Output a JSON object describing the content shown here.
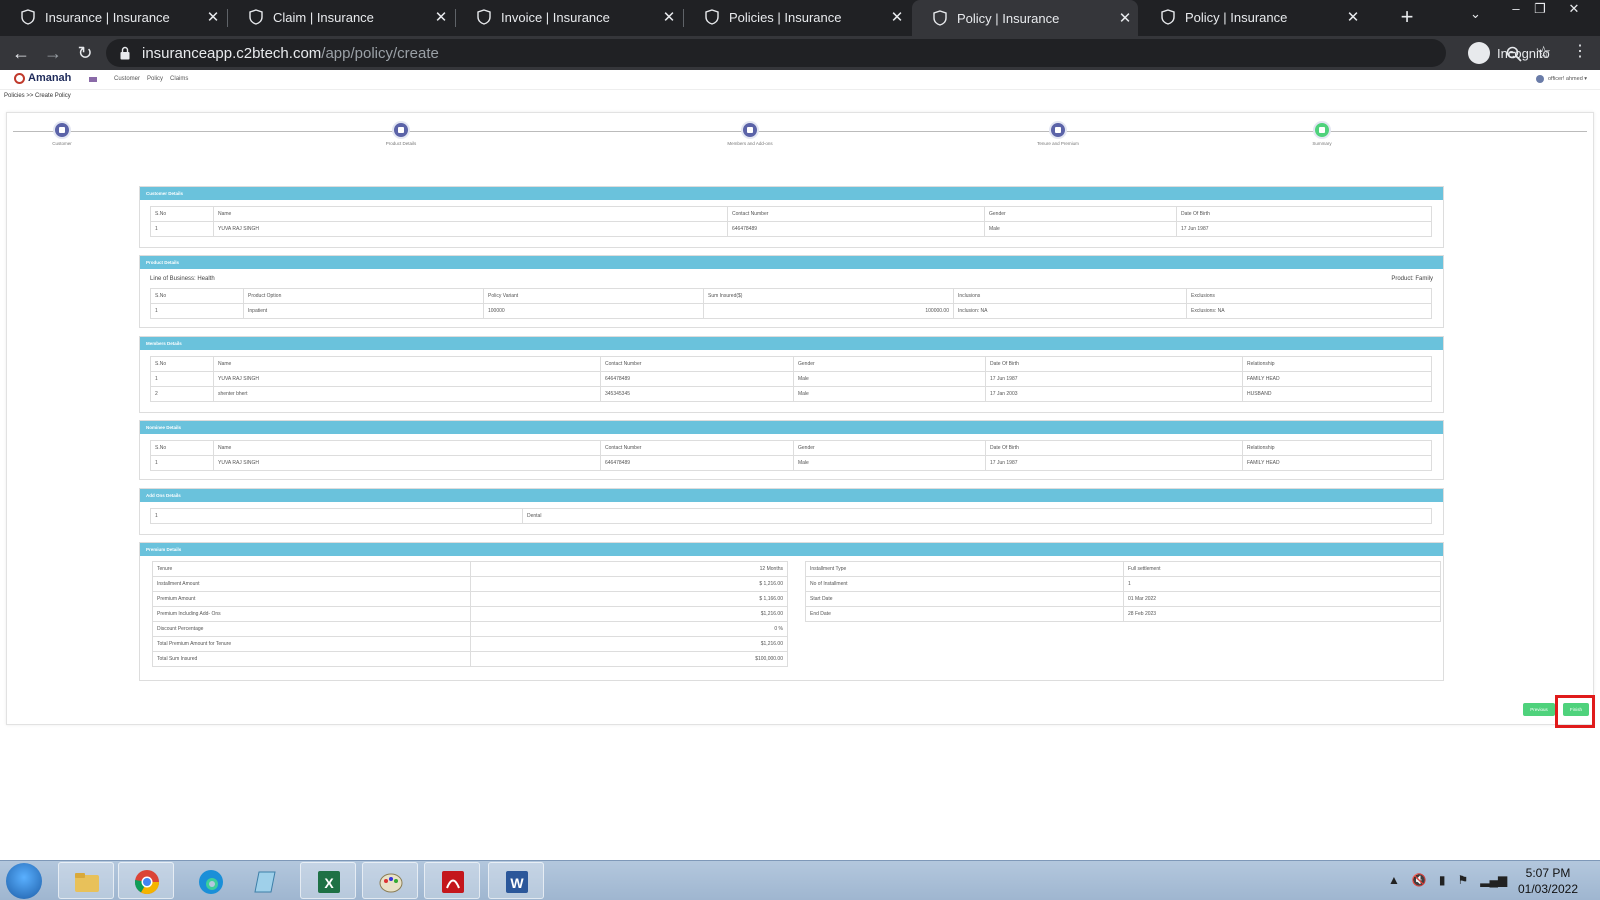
{
  "browser": {
    "tabs": [
      {
        "title": "Insurance | Insurance",
        "active": false
      },
      {
        "title": "Claim | Insurance",
        "active": false
      },
      {
        "title": "Invoice | Insurance",
        "active": false
      },
      {
        "title": "Policies | Insurance",
        "active": false
      },
      {
        "title": "Policy | Insurance",
        "active": true
      },
      {
        "title": "Policy | Insurance",
        "active": false
      }
    ],
    "url_host": "insuranceapp.c2btech.com",
    "url_path": "/app/policy/create",
    "incognito_label": "Incognito"
  },
  "app": {
    "logo_text": "Amanah",
    "nav": [
      "Customer",
      "Policy",
      "Claims"
    ],
    "user": "officer! ahmed ▾",
    "breadcrumb": "Policies >> Create Policy"
  },
  "steps": [
    {
      "label": "Customer",
      "color": "#5b63a8"
    },
    {
      "label": "Product Details",
      "color": "#5b63a8"
    },
    {
      "label": "Members and Add-ons",
      "color": "#5b63a8"
    },
    {
      "label": "Tenure and Premium",
      "color": "#5b63a8"
    },
    {
      "label": "Summary",
      "color": "#4fd27c"
    }
  ],
  "customer": {
    "heading": "Customer Details",
    "headers": [
      "S.No",
      "Name",
      "Contact Number",
      "Gender",
      "Date Of Birth"
    ],
    "rows": [
      [
        "1",
        "YUVA RAJ SINGH",
        "646478489",
        "Male",
        "17 Jun 1987"
      ]
    ]
  },
  "product": {
    "heading": "Product Details",
    "lob": "Line of Business: Health",
    "product": "Product: Family",
    "headers": [
      "S.No",
      "Product Option",
      "Policy Variant",
      "Sum Insured($)",
      "Inclusions",
      "Exclusions"
    ],
    "rows": [
      [
        "1",
        "Inpatient",
        "100000",
        "100000.00",
        "Inclusion:  NA",
        "Exclusions:  NA"
      ]
    ]
  },
  "members": {
    "heading": "Members Details",
    "headers": [
      "S.No",
      "Name",
      "Contact Number",
      "Gender",
      "Date Of Birth",
      "Relationship"
    ],
    "rows": [
      [
        "1",
        "YUVA RAJ SINGH",
        "646478489",
        "Male",
        "17 Jun 1987",
        "FAMILY HEAD"
      ],
      [
        "2",
        "shenter bhert",
        "345345345",
        "Male",
        "17 Jan 2003",
        "HUSBAND"
      ]
    ]
  },
  "nominee": {
    "heading": "Nominee Details",
    "headers": [
      "S.No",
      "Name",
      "Contact Number",
      "Gender",
      "Date Of Birth",
      "Relationship"
    ],
    "rows": [
      [
        "1",
        "YUVA RAJ SINGH",
        "646478489",
        "Male",
        "17 Jun 1987",
        "FAMILY HEAD"
      ]
    ]
  },
  "addons": {
    "heading": "Add Ons Details",
    "rows": [
      [
        "1",
        "Dental"
      ]
    ]
  },
  "premium": {
    "heading": "Premium Details",
    "left": [
      [
        "Tenure",
        "12 Months"
      ],
      [
        "Installment Amount",
        "$ 1,216.00"
      ],
      [
        "Premium Amount",
        "$ 1,166.00"
      ],
      [
        "Premium Including Add- Ons",
        "$1,216.00"
      ],
      [
        "Discount Percentage",
        "0 %"
      ],
      [
        "Total Premium Amount for Tenure",
        "$1,216.00"
      ],
      [
        "Total Sum Insured",
        "$100,000.00"
      ]
    ],
    "right": [
      [
        "Installment Type",
        "Full settlement"
      ],
      [
        "No of Installment",
        "1"
      ],
      [
        "Start Date",
        "01 Mar 2022"
      ],
      [
        "End Date",
        "28 Feb 2023"
      ]
    ]
  },
  "buttons": {
    "previous": "Previous",
    "finish": "Finish"
  },
  "taskbar": {
    "time": "5:07 PM",
    "date": "01/03/2022"
  }
}
